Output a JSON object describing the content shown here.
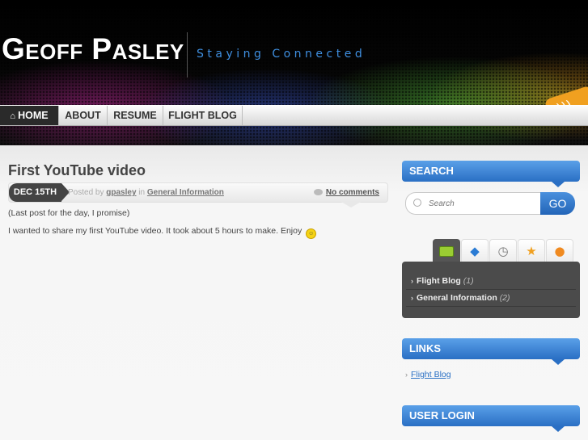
{
  "header": {
    "site_title": "Geoff Pasley",
    "tagline": "Staying Connected"
  },
  "nav": {
    "items": [
      {
        "label": "HOME",
        "icon": "home-icon",
        "active": true
      },
      {
        "label": "ABOUT",
        "active": false
      },
      {
        "label": "RESUME",
        "active": false
      },
      {
        "label": "FLIGHT BLOG",
        "active": false
      }
    ]
  },
  "post": {
    "title": "First YouTube video",
    "date": "DEC 15TH",
    "posted_by_prefix": "Posted by",
    "author": "gpasley",
    "in_text": "in",
    "category": "General Information",
    "comments": "No comments",
    "paragraphs": [
      "(Last post for the day, I promise)",
      "I wanted to share my first YouTube video. It took about 5 hours to make. Enjoy"
    ]
  },
  "sidebar": {
    "search": {
      "heading": "SEARCH",
      "placeholder": "Search",
      "button": "GO"
    },
    "tabs": {
      "icons": [
        "folder-icon",
        "tag-icon",
        "clock-icon",
        "star-icon",
        "comment-icon"
      ],
      "categories": [
        {
          "name": "Flight Blog",
          "count": "(1)"
        },
        {
          "name": "General Information",
          "count": "(2)"
        }
      ]
    },
    "links": {
      "heading": "LINKS",
      "items": [
        "Flight Blog"
      ]
    },
    "login": {
      "heading": "USER LOGIN"
    }
  },
  "colors": {
    "accent_blue": "#2a6fc4",
    "nav_active": "#2a2a2a",
    "rss_orange": "#f0a020"
  }
}
